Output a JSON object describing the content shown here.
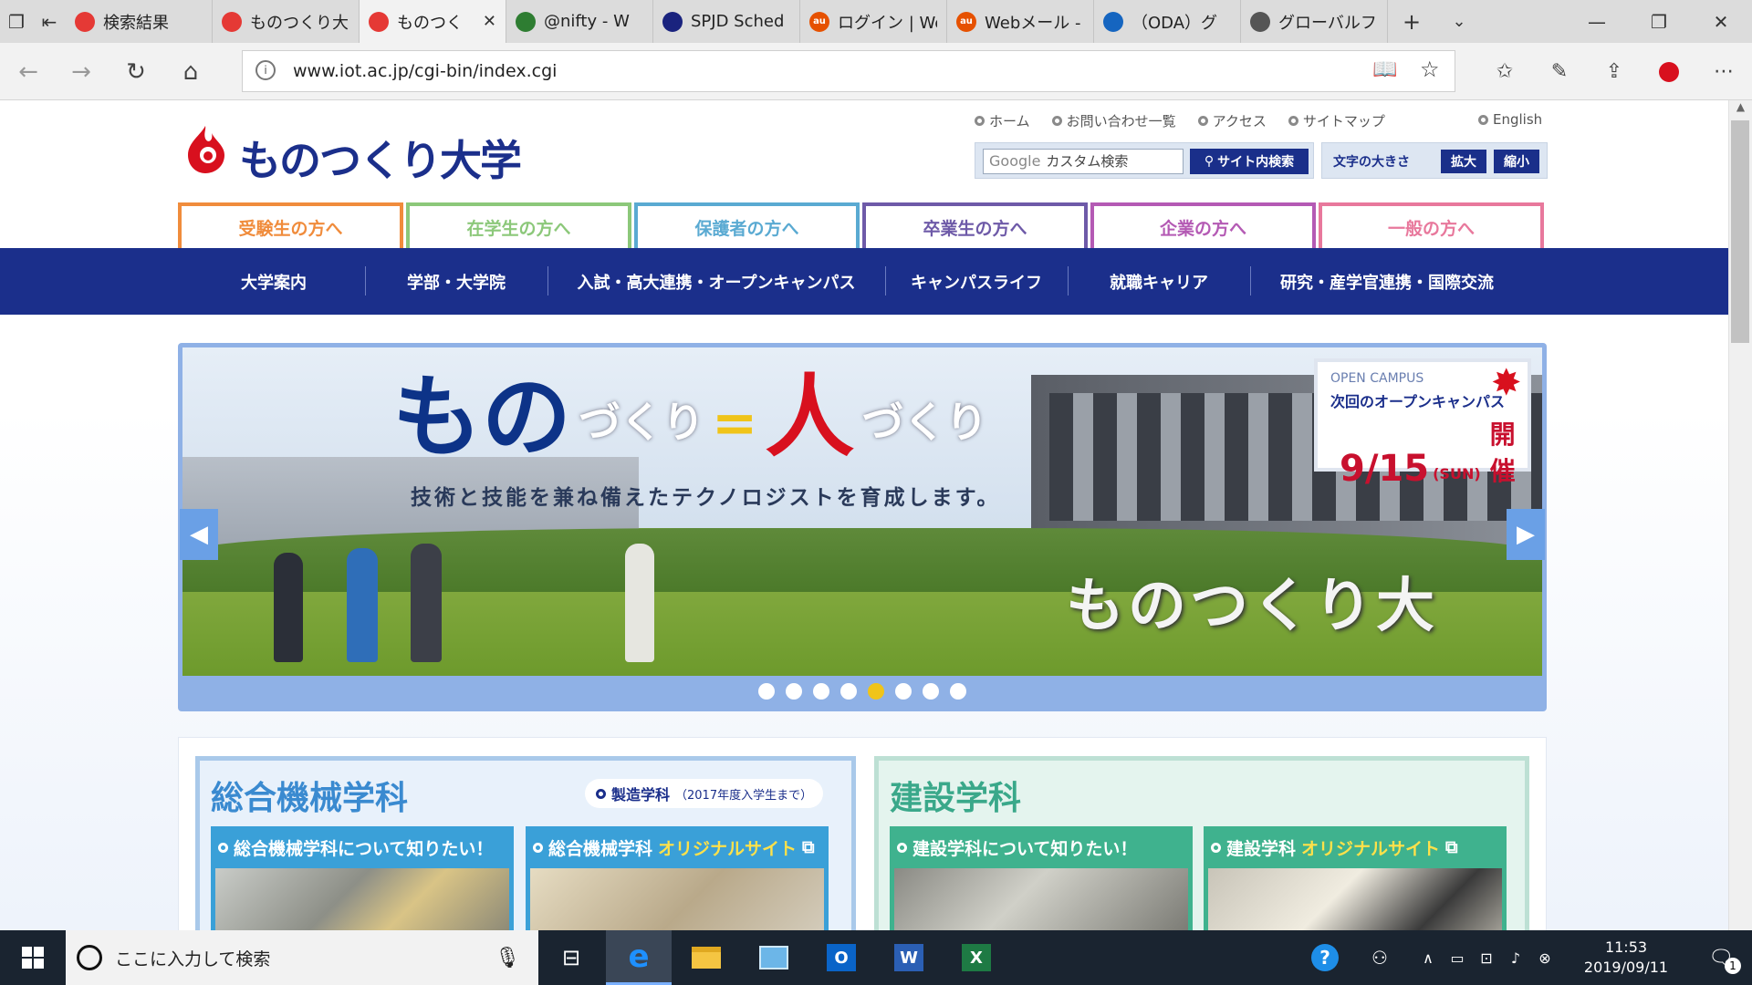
{
  "browser": {
    "tabs": [
      {
        "title": "検索結果",
        "fav_color": "#e53935",
        "fav_glyph": ""
      },
      {
        "title": "ものつくり大",
        "fav_color": "#e53935",
        "fav_glyph": ""
      },
      {
        "title": "ものつく",
        "fav_color": "#e53935",
        "fav_glyph": ""
      },
      {
        "title": "@nifty - W",
        "fav_color": "#2e7d32",
        "fav_glyph": ""
      },
      {
        "title": "SPJD Sched",
        "fav_color": "#1a237e",
        "fav_glyph": ""
      },
      {
        "title": "ログイン | We",
        "fav_color": "#e65100",
        "fav_glyph": "au"
      },
      {
        "title": "Webメール -",
        "fav_color": "#e65100",
        "fav_glyph": "au"
      },
      {
        "title": "（ODA）グ",
        "fav_color": "#1565c0",
        "fav_glyph": ""
      },
      {
        "title": "グローバルフェ",
        "fav_color": "#555555",
        "fav_glyph": ""
      }
    ],
    "active_tab_index": 2,
    "url": "www.iot.ac.jp/cgi-bin/index.cgi"
  },
  "site": {
    "logo_text": "ものつくり大学",
    "util_links": [
      "ホーム",
      "お問い合わせ一覧",
      "アクセス",
      "サイトマップ"
    ],
    "english": "English",
    "search_placeholder": "カスタム検索",
    "search_google": "Google",
    "search_button": "サイト内検索",
    "font_size_label": "文字の大きさ",
    "font_up": "拡大",
    "font_down": "縮小",
    "audience_tabs": [
      {
        "label": "受験生の方へ",
        "color": "#f08c3c"
      },
      {
        "label": "在学生の方へ",
        "color": "#8cc87a"
      },
      {
        "label": "保護者の方へ",
        "color": "#5aaad2"
      },
      {
        "label": "卒業生の方へ",
        "color": "#6e5aa8"
      },
      {
        "label": "企業の方へ",
        "color": "#b45ab4"
      },
      {
        "label": "一般の方へ",
        "color": "#e8789c"
      }
    ],
    "main_nav": [
      "大学案内",
      "学部・大学院",
      "入試・高大連携・オープンキャンパス",
      "キャンパスライフ",
      "就職キャリア",
      "研究・産学官連携・国際交流"
    ]
  },
  "hero": {
    "headline_big1": "もの",
    "headline_small1": "づくり",
    "headline_eq": "=",
    "headline_big2": "人",
    "headline_small2": "づくり",
    "subline": "技術と技能を兼ね備えたテクノロジストを育成します。",
    "building_text": "ものつくり大",
    "oc_en": "OPEN CAMPUS",
    "oc_jp": "次回のオープンキャンパス",
    "oc_date": "9/15",
    "oc_day": "(SUN)",
    "oc_held": "開催",
    "slides": 8,
    "active_slide": 4
  },
  "depts": {
    "mech_title": "総合機械学科",
    "mech_sub": "製造学科",
    "mech_sub_note": "（2017年度入学生まで）",
    "mech_card1": "総合機械学科について知りたい！",
    "mech_card2_a": "総合機械学科",
    "mech_card2_b": "オリジナルサイト",
    "civil_title": "建設学科",
    "civil_card1": "建設学科について知りたい！",
    "civil_card2_a": "建設学科",
    "civil_card2_b": "オリジナルサイト"
  },
  "taskbar": {
    "search_placeholder": "ここに入力して検索",
    "time": "11:53",
    "date": "2019/09/11",
    "notif_count": "1"
  },
  "colors": {
    "nav_blue": "#1b2f8b",
    "brand_red": "#d8101e",
    "hero_frame": "#8fb1e6"
  }
}
